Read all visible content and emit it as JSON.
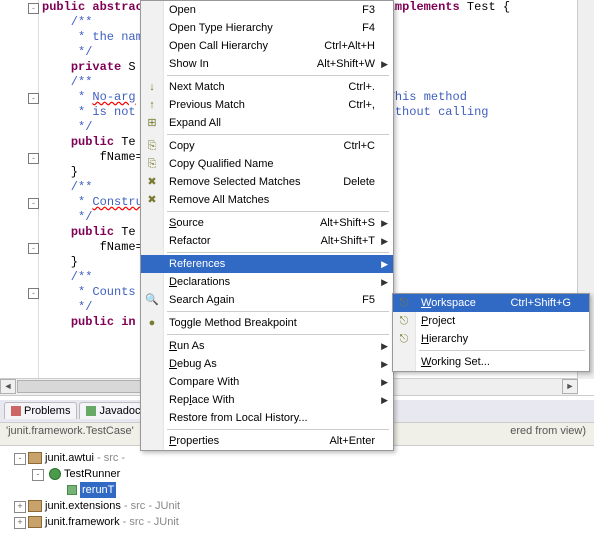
{
  "editor": {
    "lines": [
      {
        "fold": "-",
        "seg": [
          {
            "c": "kw",
            "t": "public abstract"
          },
          {
            "c": "",
            "t": " "
          },
          {
            "c": "",
            "t": "                                "
          },
          {
            "c": "kw",
            "t": "implements"
          },
          {
            "c": "",
            "t": " Test {"
          }
        ]
      },
      {
        "seg": [
          {
            "c": "cm",
            "t": "    /**"
          }
        ]
      },
      {
        "seg": [
          {
            "c": "cm",
            "t": "     * the name"
          }
        ]
      },
      {
        "seg": [
          {
            "c": "cm",
            "t": "     */"
          }
        ]
      },
      {
        "seg": [
          {
            "c": "",
            "t": "    "
          },
          {
            "c": "kw",
            "t": "private"
          },
          {
            "c": "",
            "t": " S"
          }
        ]
      },
      {
        "seg": [
          {
            "c": "",
            "t": ""
          }
        ]
      },
      {
        "fold": "-",
        "seg": [
          {
            "c": "cm",
            "t": "    /**"
          }
        ]
      },
      {
        "seg": [
          {
            "c": "cm",
            "t": "     * "
          },
          {
            "c": "err cm",
            "t": "No-arg"
          },
          {
            "c": "cm",
            "t": "                             "
          },
          {
            "c": "cm",
            "t": "tion. This method"
          }
        ]
      },
      {
        "seg": [
          {
            "c": "cm",
            "t": "     * is not                             tals without calling"
          }
        ]
      },
      {
        "seg": [
          {
            "c": "cm",
            "t": "     */"
          }
        ]
      },
      {
        "fold": "-",
        "seg": [
          {
            "c": "",
            "t": "    "
          },
          {
            "c": "kw",
            "t": "public"
          },
          {
            "c": "",
            "t": " Te"
          }
        ]
      },
      {
        "seg": [
          {
            "c": "",
            "t": "        fName="
          }
        ]
      },
      {
        "seg": [
          {
            "c": "",
            "t": "    }"
          }
        ]
      },
      {
        "fold": "-",
        "seg": [
          {
            "c": "cm",
            "t": "    /**"
          }
        ]
      },
      {
        "seg": [
          {
            "c": "cm",
            "t": "     * "
          },
          {
            "c": "err cm",
            "t": "Constru"
          },
          {
            "c": "cm",
            "t": "                              "
          },
          {
            "c": "cm",
            "t": "name."
          }
        ]
      },
      {
        "seg": [
          {
            "c": "cm",
            "t": "     */"
          }
        ]
      },
      {
        "fold": "-",
        "seg": [
          {
            "c": "",
            "t": "    "
          },
          {
            "c": "kw",
            "t": "public"
          },
          {
            "c": "",
            "t": " Te"
          }
        ]
      },
      {
        "seg": [
          {
            "c": "",
            "t": "        fName="
          }
        ]
      },
      {
        "seg": [
          {
            "c": "",
            "t": "    }"
          }
        ]
      },
      {
        "fold": "-",
        "seg": [
          {
            "c": "cm",
            "t": "    /**"
          }
        ]
      },
      {
        "seg": [
          {
            "c": "cm",
            "t": "     * Counts "
          }
        ]
      },
      {
        "seg": [
          {
            "c": "cm",
            "t": "     */"
          }
        ]
      },
      {
        "seg": [
          {
            "c": "",
            "t": "    "
          },
          {
            "c": "kw",
            "t": "public"
          },
          {
            "c": "",
            "t": " "
          },
          {
            "c": "kw",
            "t": "in"
          }
        ]
      }
    ]
  },
  "menu": {
    "items": [
      {
        "label": "Open",
        "shortcut": "F3"
      },
      {
        "label": "Open Type Hierarchy",
        "shortcut": "F4"
      },
      {
        "label": "Open Call Hierarchy",
        "shortcut": "Ctrl+Alt+H"
      },
      {
        "label": "Show In",
        "shortcut": "Alt+Shift+W",
        "sub": true
      },
      {
        "sep": true
      },
      {
        "icon": "↓",
        "label": "Next Match",
        "shortcut": "Ctrl+."
      },
      {
        "icon": "↑",
        "label": "Previous Match",
        "shortcut": "Ctrl+,"
      },
      {
        "icon": "⊞",
        "label": "Expand All",
        "shortcut": ""
      },
      {
        "sep": true
      },
      {
        "icon": "⎘",
        "label": "Copy",
        "shortcut": "Ctrl+C"
      },
      {
        "icon": "⎘",
        "label": "Copy Qualified Name",
        "shortcut": ""
      },
      {
        "icon": "✖",
        "label": "Remove Selected Matches",
        "shortcut": "Delete"
      },
      {
        "icon": "✖",
        "label": "Remove All Matches",
        "shortcut": ""
      },
      {
        "sep": true
      },
      {
        "label": "Source",
        "shortcut": "Alt+Shift+S",
        "sub": true,
        "ul": "S"
      },
      {
        "label": "Refactor",
        "shortcut": "Alt+Shift+T",
        "sub": true,
        "ul": "T"
      },
      {
        "sep": true
      },
      {
        "label": "References",
        "shortcut": "",
        "sub": true,
        "sel": true
      },
      {
        "label": "Declarations",
        "shortcut": "",
        "sub": true,
        "ul": "D"
      },
      {
        "icon": "🔍",
        "label": "Search Again",
        "shortcut": "F5"
      },
      {
        "sep": true
      },
      {
        "icon": "●",
        "label": "Toggle Method Breakpoint",
        "shortcut": ""
      },
      {
        "sep": true
      },
      {
        "label": "Run As",
        "shortcut": "",
        "sub": true,
        "ul": "R"
      },
      {
        "label": "Debug As",
        "shortcut": "",
        "sub": true,
        "ul": "D"
      },
      {
        "label": "Compare With",
        "shortcut": "",
        "sub": true
      },
      {
        "label": "Replace With",
        "shortcut": "",
        "sub": true,
        "ul": "l"
      },
      {
        "label": "Restore from Local History...",
        "shortcut": ""
      },
      {
        "sep": true
      },
      {
        "label": "Properties",
        "shortcut": "Alt+Enter",
        "ul": "P"
      }
    ]
  },
  "submenu": {
    "items": [
      {
        "icon": "⎋",
        "label": "Workspace",
        "shortcut": "Ctrl+Shift+G",
        "sel": true,
        "ul": "W"
      },
      {
        "icon": "⎋",
        "label": "Project",
        "ul": "P"
      },
      {
        "icon": "⎋",
        "label": "Hierarchy",
        "ul": "H"
      },
      {
        "sep": true
      },
      {
        "label": "Working Set...",
        "ul": "W"
      }
    ]
  },
  "tabs": [
    {
      "name": "Problems",
      "color": "#c66"
    },
    {
      "name": "Javadoc",
      "color": "#6a6"
    }
  ],
  "filterbar": {
    "left": "'junit.framework.TestCase'",
    "right": "ered from view)"
  },
  "tree": [
    {
      "indent": 0,
      "twist": "-",
      "kind": "pkg",
      "label": "junit.awtui",
      "suffix": " - src - "
    },
    {
      "indent": 1,
      "twist": "-",
      "kind": "cls",
      "label": "TestRunner"
    },
    {
      "indent": 2,
      "twist": "",
      "kind": "mtd",
      "label": "rerunT",
      "sel": true
    },
    {
      "indent": 0,
      "twist": "+",
      "kind": "pkg",
      "label": "junit.extensions",
      "suffix": " - src - JUnit"
    },
    {
      "indent": 0,
      "twist": "+",
      "kind": "pkg",
      "label": "junit.framework",
      "suffix": " - src - JUnit"
    }
  ]
}
